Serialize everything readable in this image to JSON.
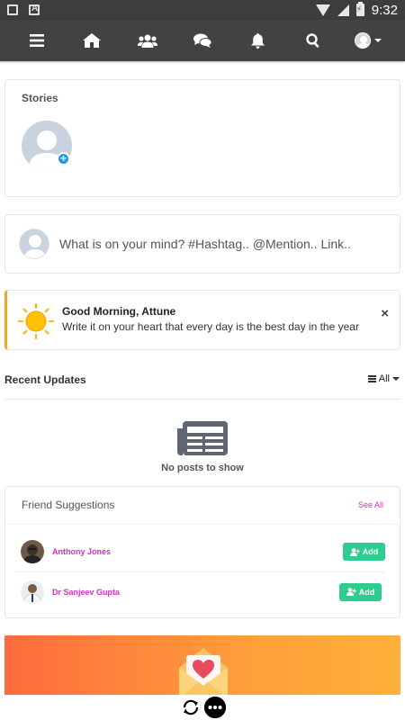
{
  "status_bar": {
    "time": "9:32"
  },
  "nav": {
    "items": [
      "menu-icon",
      "home-icon",
      "friends-icon",
      "messages-icon",
      "notifications-icon",
      "search-icon",
      "profile-avatar"
    ]
  },
  "stories": {
    "title": "Stories",
    "add_badge": "+"
  },
  "composer": {
    "placeholder": "What is on your mind? #Hashtag.. @Mention.. Link.."
  },
  "greeting": {
    "title": "Good Morning, Attune",
    "text": "Write it on your heart that every day is the best day in the year",
    "close": "×"
  },
  "recent": {
    "title": "Recent Updates",
    "filter": "All",
    "empty_text": "No posts to show"
  },
  "friend_suggestions": {
    "title": "Friend Suggestions",
    "see_all": "See All",
    "people": [
      {
        "name": "Anthony Jones",
        "button": "Add"
      },
      {
        "name": "Dr Sanjeev Gupta",
        "button": "Add"
      }
    ]
  },
  "colors": {
    "navbar": "#444240",
    "accent_pink": "#d42ecc",
    "add_green": "#2ecc8f",
    "greeting_border": "#f5a623",
    "promo_start": "#ff6b3d",
    "promo_end": "#ffb03a"
  }
}
